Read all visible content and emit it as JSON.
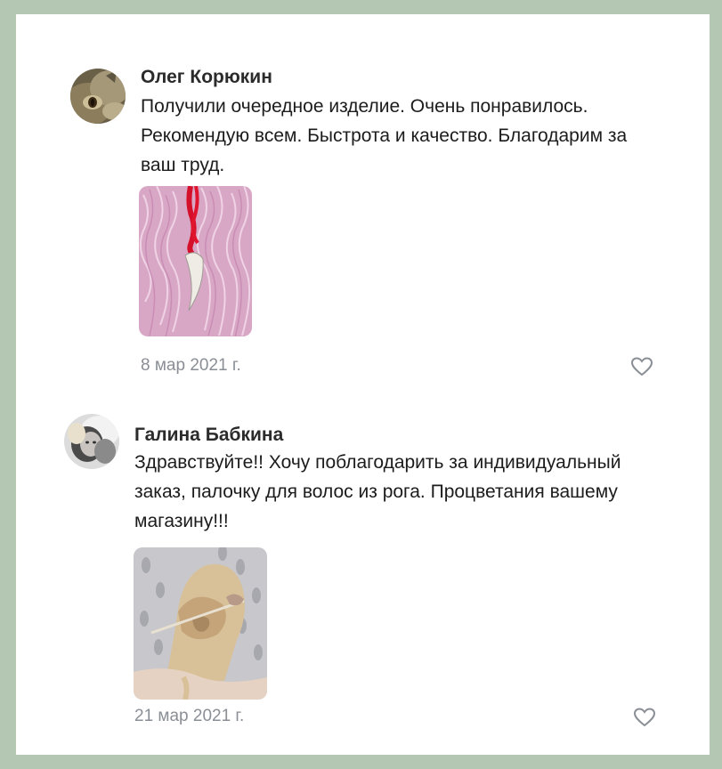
{
  "comments": [
    {
      "author": "Олег Корюкин",
      "text": "Получили очередное изделие. Очень понравилось. Рекомендую всем. Быстрота и качество. Благодарим за ваш труд.",
      "date": "8 мар 2021 г.",
      "photo": "pendant-icon",
      "avatar": "cat-avatar"
    },
    {
      "author": "Галина Бабкина",
      "text": "Здравствуйте!! Хочу поблагодарить за индивидуальный заказ, палочку для волос из рога. Процветания вашему магазину!!!",
      "date": "21 мар 2021 г.",
      "photo": "hairstick-photo",
      "avatar": "woman-avatar"
    }
  ],
  "colors": {
    "frame": "#b3c7b2",
    "card": "#ffffff",
    "date": "#8a8f96",
    "like": "#8a8f96"
  }
}
